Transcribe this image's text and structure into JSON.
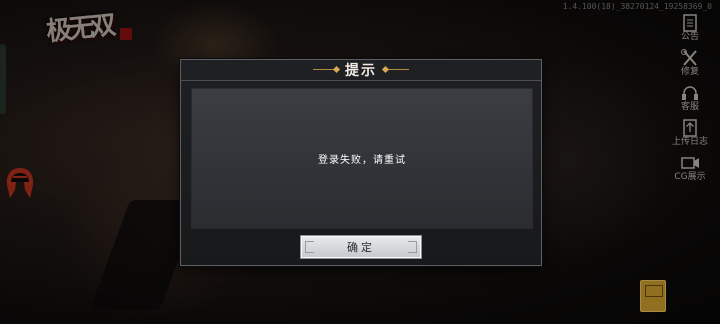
{
  "game": {
    "logo_text": "极无双",
    "version": "1.4.100(18)_38270124_19258369_0"
  },
  "side_menu": [
    {
      "label": "公告",
      "icon": "notice-icon"
    },
    {
      "label": "修复",
      "icon": "repair-icon"
    },
    {
      "label": "客服",
      "icon": "support-icon"
    },
    {
      "label": "上传日志",
      "icon": "upload-log-icon"
    },
    {
      "label": "CG展示",
      "icon": "cg-video-icon"
    }
  ],
  "dialog": {
    "title": "提示",
    "message": "登录失败，请重试",
    "confirm_label": "确定"
  },
  "colors": {
    "dialog_bg": "#1f2023",
    "title_accent": "#d9a854",
    "button_bg": "#dfe1e4",
    "helmet": "#b0301f"
  }
}
